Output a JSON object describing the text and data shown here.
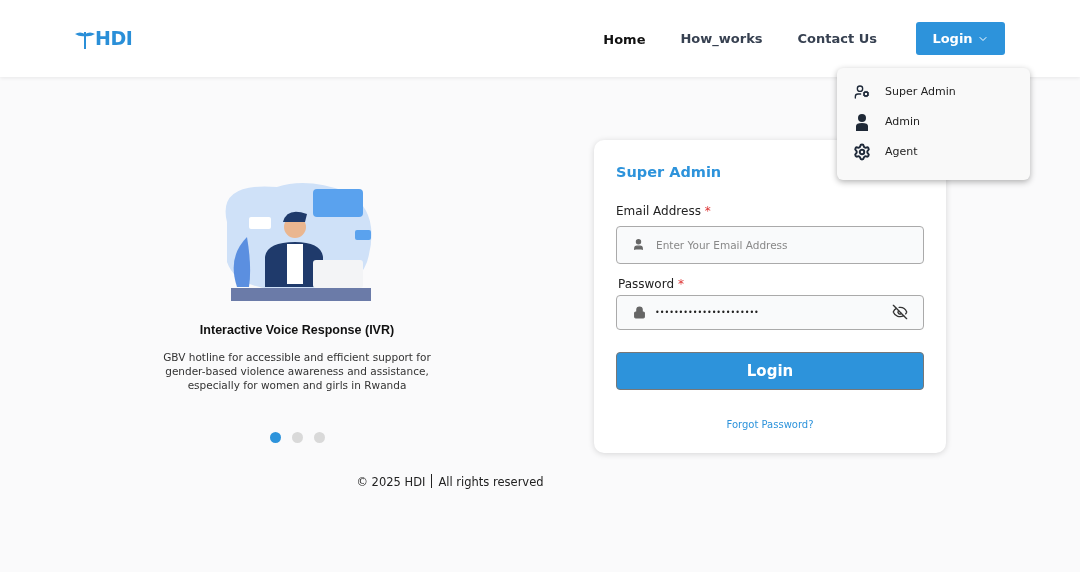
{
  "header": {
    "logo": "HDI",
    "nav": [
      {
        "label": "Home",
        "selected": true
      },
      {
        "label": "How_works",
        "selected": false
      },
      {
        "label": "Contact Us",
        "selected": false
      }
    ],
    "login_button": "Login"
  },
  "login_menu": [
    {
      "label": "Super Admin",
      "kind": "superadmin"
    },
    {
      "label": "Admin",
      "kind": "admin"
    },
    {
      "label": "Agent",
      "kind": "agent"
    }
  ],
  "carousel": {
    "title": "Interactive Voice Response (IVR)",
    "description": "GBV hotline for accessible and efficient support for gender-based violence awareness and assistance, especially for women and girls in Rwanda",
    "dots": [
      {
        "selected": true
      },
      {
        "selected": false
      },
      {
        "selected": false
      }
    ]
  },
  "login_card": {
    "title": "Super Admin",
    "email_label": "Email Address",
    "email_placeholder": "Enter Your Email Address",
    "password_label": "Password",
    "required_mark": "*",
    "password_value": "••••••••••••••••••••••",
    "submit": "Login",
    "forgot": "Forgot Password?"
  },
  "footer": {
    "copyright": "© 2025 HDI",
    "rights": "All rights reserved"
  }
}
